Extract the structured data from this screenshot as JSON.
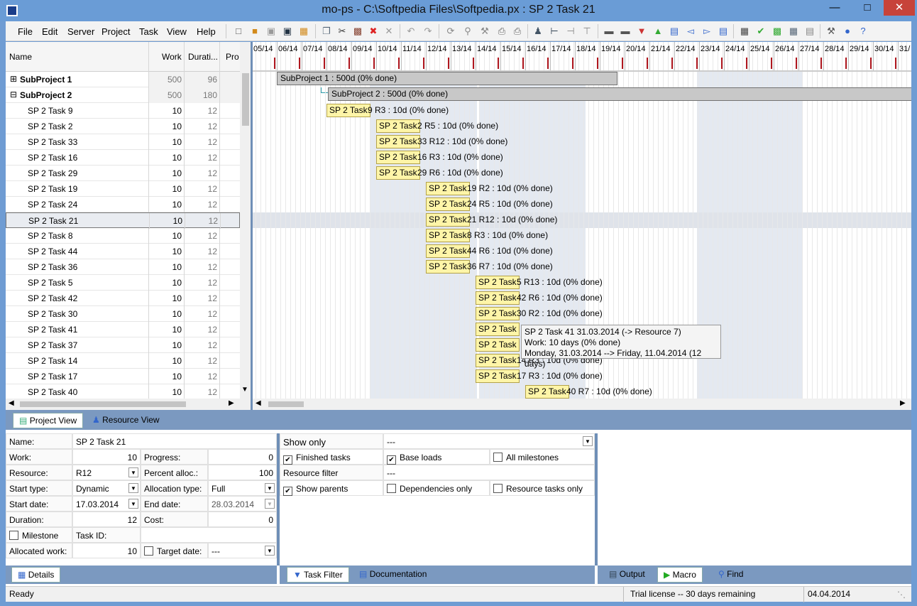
{
  "window": {
    "title": "mo-ps - C:\\Softpedia Files\\Softpedia.px : SP 2 Task 21"
  },
  "menu": [
    "File",
    "Edit",
    "Server",
    "Project",
    "Task",
    "View",
    "Help"
  ],
  "grid": {
    "headers": {
      "name": "Name",
      "work": "Work",
      "duration": "Durati...",
      "progress": "Pro"
    },
    "rows": [
      {
        "name": "SubProject 1",
        "work": "500",
        "duration": "96",
        "group": true,
        "expander": "⊞"
      },
      {
        "name": "SubProject 2",
        "work": "500",
        "duration": "180",
        "group": true,
        "expander": "⊟"
      },
      {
        "name": "SP 2 Task 9",
        "work": "10",
        "duration": "12"
      },
      {
        "name": "SP 2 Task 2",
        "work": "10",
        "duration": "12"
      },
      {
        "name": "SP 2 Task 33",
        "work": "10",
        "duration": "12"
      },
      {
        "name": "SP 2 Task 16",
        "work": "10",
        "duration": "12"
      },
      {
        "name": "SP 2 Task 29",
        "work": "10",
        "duration": "12"
      },
      {
        "name": "SP 2 Task 19",
        "work": "10",
        "duration": "12"
      },
      {
        "name": "SP 2 Task 24",
        "work": "10",
        "duration": "12"
      },
      {
        "name": "SP 2 Task 21",
        "work": "10",
        "duration": "12",
        "selected": true
      },
      {
        "name": "SP 2 Task 8",
        "work": "10",
        "duration": "12"
      },
      {
        "name": "SP 2 Task 44",
        "work": "10",
        "duration": "12"
      },
      {
        "name": "SP 2 Task 36",
        "work": "10",
        "duration": "12"
      },
      {
        "name": "SP 2 Task 5",
        "work": "10",
        "duration": "12"
      },
      {
        "name": "SP 2 Task 42",
        "work": "10",
        "duration": "12"
      },
      {
        "name": "SP 2 Task 30",
        "work": "10",
        "duration": "12"
      },
      {
        "name": "SP 2 Task 41",
        "work": "10",
        "duration": "12"
      },
      {
        "name": "SP 2 Task 37",
        "work": "10",
        "duration": "12"
      },
      {
        "name": "SP 2 Task 14",
        "work": "10",
        "duration": "12"
      },
      {
        "name": "SP 2 Task 17",
        "work": "10",
        "duration": "12"
      },
      {
        "name": "SP 2 Task 40",
        "work": "10",
        "duration": "12"
      }
    ]
  },
  "gantt": {
    "dates": [
      "05/14",
      "06/14",
      "07/14",
      "08/14",
      "09/14",
      "10/14",
      "11/14",
      "12/14",
      "13/14",
      "14/14",
      "15/14",
      "16/14",
      "17/14",
      "18/14",
      "19/14",
      "20/14",
      "21/14",
      "22/14",
      "23/14",
      "24/14",
      "25/14",
      "26/14",
      "27/14",
      "28/14",
      "29/14",
      "30/14",
      "31/"
    ],
    "bars": [
      {
        "type": "summary",
        "label": "SubProject 1  : 500d (0% done)"
      },
      {
        "type": "summary",
        "label": "SubProject 2  : 500d (0% done)"
      },
      {
        "label": "SP 2 Task",
        "rest": "9 R3 : 10d (0% done)"
      },
      {
        "label": "SP 2 Task",
        "rest": "2 R5 : 10d (0% done)"
      },
      {
        "label": "SP 2 Task",
        "rest": "33 R12 : 10d (0% done)"
      },
      {
        "label": "SP 2 Task",
        "rest": "16 R3 : 10d (0% done)"
      },
      {
        "label": "SP 2 Task",
        "rest": "29 R6 : 10d (0% done)"
      },
      {
        "label": "SP 2 Task",
        "rest": "19 R2 : 10d (0% done)"
      },
      {
        "label": "SP 2 Task",
        "rest": "24 R5 : 10d (0% done)"
      },
      {
        "label": "SP 2 Task",
        "rest": "21 R12 : 10d (0% done)"
      },
      {
        "label": "SP 2 Task",
        "rest": "8 R3 : 10d (0% done)"
      },
      {
        "label": "SP 2 Task",
        "rest": "44 R6 : 10d (0% done)"
      },
      {
        "label": "SP 2 Task",
        "rest": "36 R7 : 10d (0% done)"
      },
      {
        "label": "SP 2 Task",
        "rest": "5 R13 : 10d (0% done)"
      },
      {
        "label": "SP 2 Task",
        "rest": "42 R6 : 10d (0% done)"
      },
      {
        "label": "SP 2 Task",
        "rest": "30 R2 : 10d (0% done)"
      },
      {
        "label": "SP 2 Task",
        "rest": ""
      },
      {
        "label": "SP 2 Task",
        "rest": ""
      },
      {
        "label": "SP 2 Task",
        "rest": "14 R3 : 10d (0% done)"
      },
      {
        "label": "SP 2 Task",
        "rest": "17 R3 : 10d (0% done)"
      },
      {
        "label": "SP 2 Task",
        "rest": "40 R7 : 10d (0% done)"
      }
    ],
    "tooltip": [
      "SP 2 Task 41 31.03.2014 (-> Resource 7)",
      "Work: 10 days (0% done)",
      "Monday, 31.03.2014 --> Friday, 11.04.2014 (12 days)"
    ]
  },
  "view_tabs": {
    "project": "Project View",
    "resource": "Resource View"
  },
  "details": {
    "name_label": "Name:",
    "name": "SP 2 Task 21",
    "work_label": "Work:",
    "work": "10",
    "progress_label": "Progress:",
    "progress": "0",
    "resource_label": "Resource:",
    "resource": "R12",
    "percent_label": "Percent alloc.:",
    "percent": "100",
    "start_type_label": "Start type:",
    "start_type": "Dynamic",
    "alloc_type_label": "Allocation type:",
    "alloc_type": "Full",
    "start_date_label": "Start date:",
    "start_date": "17.03.2014",
    "end_date_label": "End date:",
    "end_date": "28.03.2014",
    "duration_label": "Duration:",
    "duration": "12",
    "cost_label": "Cost:",
    "cost": "0",
    "milestone_label": "Milestone",
    "task_id_label": "Task ID:",
    "alloc_work_label": "Allocated work:",
    "alloc_work": "10",
    "target_date_label": "Target date:",
    "target_date": "---"
  },
  "filters": {
    "show_only_label": "Show only",
    "show_only": "---",
    "finished": "Finished tasks",
    "base_loads": "Base loads",
    "all_milestones": "All milestones",
    "resource_filter_label": "Resource filter",
    "resource_filter": "---",
    "show_parents": "Show parents",
    "deps_only": "Dependencies only",
    "res_tasks_only": "Resource tasks only"
  },
  "bottom_tabs": {
    "details": "Details",
    "task_filter": "Task Filter",
    "documentation": "Documentation",
    "output": "Output",
    "macro": "Macro",
    "find": "Find"
  },
  "status": {
    "ready": "Ready",
    "license": "Trial license -- 30 days remaining",
    "date": "04.04.2014"
  }
}
